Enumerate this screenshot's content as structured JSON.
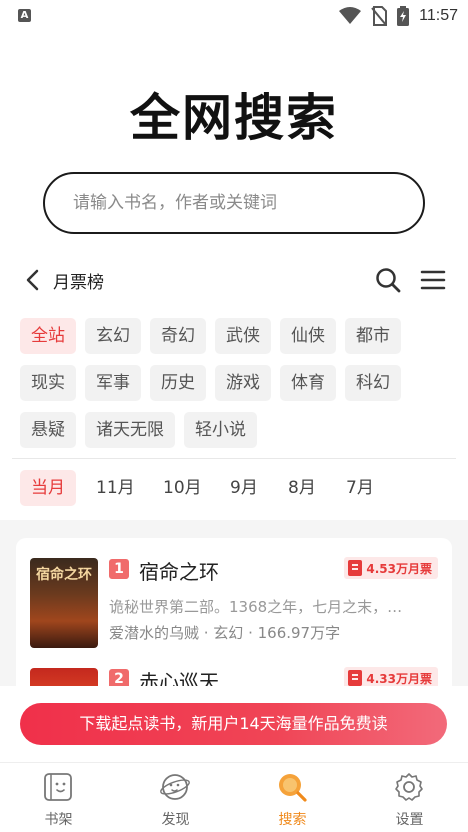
{
  "status_bar": {
    "left_icon": "A",
    "time": "11:57",
    "icons": [
      "wifi-icon",
      "no-sim-icon",
      "battery-icon"
    ]
  },
  "page": {
    "title": "全网搜索"
  },
  "search": {
    "placeholder": "请输入书名，作者或关键词"
  },
  "rank": {
    "title": "月票榜"
  },
  "categories": {
    "items": [
      "全站",
      "玄幻",
      "奇幻",
      "武侠",
      "仙侠",
      "都市",
      "现实",
      "军事",
      "历史",
      "游戏",
      "体育",
      "科幻",
      "悬疑",
      "诸天无限",
      "轻小说"
    ],
    "selected": "全站"
  },
  "months": {
    "items": [
      "当月",
      "11月",
      "10月",
      "9月",
      "8月",
      "7月"
    ],
    "selected": "当月"
  },
  "books": [
    {
      "rank": "1",
      "title": "宿命之环",
      "votes": "4.53万月票",
      "description": "诡秘世界第二部。1368之年，七月之末，…",
      "meta": "爱潜水的乌贼 · 玄幻 · 166.97万字",
      "cover_text": "宿命之环"
    },
    {
      "rank": "2",
      "title": "赤心巡天",
      "votes": "4.33万月票"
    }
  ],
  "banner": {
    "text": "下载起点读书，新用户14天海量作品免费读"
  },
  "bottom_nav": {
    "items": [
      {
        "label": "书架",
        "icon": "bookshelf-icon"
      },
      {
        "label": "发现",
        "icon": "discover-icon"
      },
      {
        "label": "搜索",
        "icon": "search-nav-icon"
      },
      {
        "label": "设置",
        "icon": "settings-icon"
      }
    ],
    "active": "搜索",
    "active_color": "#f08a1c"
  },
  "colors": {
    "accent_red": "#e63b3b",
    "chip_active_bg": "#fde8e8",
    "banner": "#f0304a"
  }
}
